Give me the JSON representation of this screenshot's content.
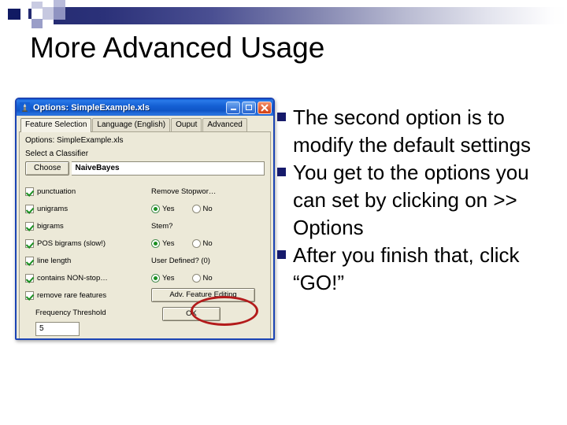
{
  "slide": {
    "title": "More Advanced Usage",
    "decoration": {
      "accent_color": "#161a6b",
      "gradient_from": "#232a70",
      "gradient_to": "#ffffff"
    },
    "bullets": [
      "The second option is to modify the default settings",
      "You get to the options you can set by clicking on >> Options",
      "After you finish that, click “GO!”"
    ],
    "bullet_marker_color": "#161a6b"
  },
  "dialog": {
    "title": "Options: SimpleExample.xls",
    "title_icon": "app-icon",
    "window_buttons": {
      "minimize": "–",
      "maximize": "☐",
      "close": "✕"
    },
    "tabs": [
      {
        "label": "Feature Selection",
        "active": true
      },
      {
        "label": "Language (English)",
        "active": false
      },
      {
        "label": "Ouput",
        "active": false
      },
      {
        "label": "Advanced",
        "active": false
      }
    ],
    "panel_caption": "Options: SimpleExample.xls",
    "classifier_section": {
      "label": "Select a Classifier",
      "choose_label": "Choose",
      "value": "NaiveBayes"
    },
    "checkboxes": [
      {
        "label": "punctuation",
        "checked": true
      },
      {
        "label": "unigrams",
        "checked": true
      },
      {
        "label": "bigrams",
        "checked": true
      },
      {
        "label": "POS bigrams (slow!)",
        "checked": true
      },
      {
        "label": "line length",
        "checked": true
      },
      {
        "label": "contains NON-stop…",
        "checked": true
      },
      {
        "label": "remove rare features",
        "checked": true
      }
    ],
    "right_options": [
      {
        "label": "Remove Stopwor…",
        "yes_label": "Yes",
        "no_label": "No",
        "selected": "Yes"
      },
      {
        "label": "Stem?",
        "yes_label": "Yes",
        "no_label": "No",
        "selected": "Yes"
      },
      {
        "label": "User Defined? (0)",
        "yes_label": "Yes",
        "no_label": "No",
        "selected": "Yes"
      }
    ],
    "adv_feature_button": "Adv. Feature Editing",
    "ok_button": "OK",
    "frequency_threshold": {
      "label": "Frequency Threshold",
      "value": "5"
    }
  },
  "annotation": {
    "shape": "ellipse",
    "color": "#b31b1b"
  }
}
